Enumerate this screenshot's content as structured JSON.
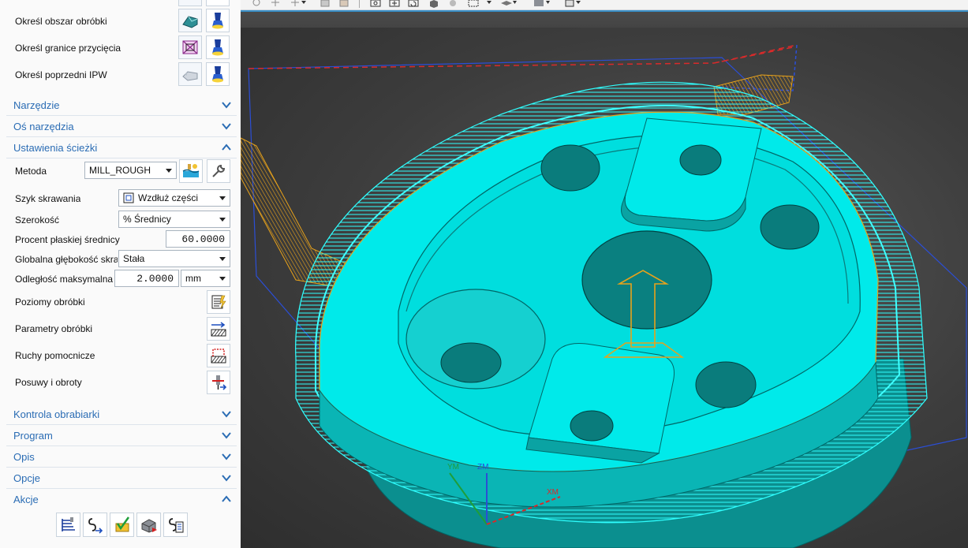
{
  "selection_rows": [
    {
      "label": "Określ obszar obróbki",
      "icon": "area-shape-icon",
      "pick_icon": "flashlight-icon"
    },
    {
      "label": "Określ granice przycięcia",
      "icon": "trim-boundary-icon",
      "pick_icon": "flashlight-icon"
    },
    {
      "label": "Określ poprzedni IPW",
      "icon": "ipw-icon",
      "pick_icon": "flashlight-icon"
    }
  ],
  "sections_top": [
    {
      "label": "Narzędzie",
      "expanded": false
    },
    {
      "label": "Oś narzędzia",
      "expanded": false
    },
    {
      "label": "Ustawienia ścieżki",
      "expanded": true
    }
  ],
  "path_settings": {
    "method_label": "Metoda",
    "method_value": "MILL_ROUGH",
    "cut_pattern_label": "Szyk skrawania",
    "cut_pattern_value": "Wzdłuż części",
    "stepover_label": "Szerokość",
    "stepover_value": "% Średnicy",
    "flat_diameter_label": "Procent płaskiej średnicy",
    "flat_diameter_value": "60.0000",
    "global_depth_label": "Globalna głębokość skra",
    "global_depth_value": "Stała",
    "max_distance_label": "Odległość maksymalna",
    "max_distance_value": "2.0000",
    "max_distance_unit": "mm",
    "cut_levels_label": "Poziomy obróbki",
    "cutting_params_label": "Parametry obróbki",
    "non_cutting_label": "Ruchy pomocnicze",
    "feeds_speeds_label": "Posuwy i obroty"
  },
  "sections_bottom": [
    {
      "label": "Kontrola obrabiarki",
      "expanded": false
    },
    {
      "label": "Program",
      "expanded": false
    },
    {
      "label": "Opis",
      "expanded": false
    },
    {
      "label": "Opcje",
      "expanded": false
    },
    {
      "label": "Akcje",
      "expanded": true
    }
  ],
  "actions": [
    "generate-icon",
    "replay-icon",
    "verify-icon",
    "simulate-icon",
    "list-icon"
  ],
  "viewport": {
    "axis_labels": {
      "x": "XM",
      "y": "YM",
      "z": "ZM"
    },
    "colors": {
      "part": "#00eaea",
      "part_shade": "#0aa3a3",
      "toolpath": "#e8a21a",
      "boundary": "#2b4ed6",
      "rapid": "#d92a2a"
    }
  },
  "colors": {
    "accent": "#2a6cb4",
    "section_text": "#2a6cb4"
  }
}
